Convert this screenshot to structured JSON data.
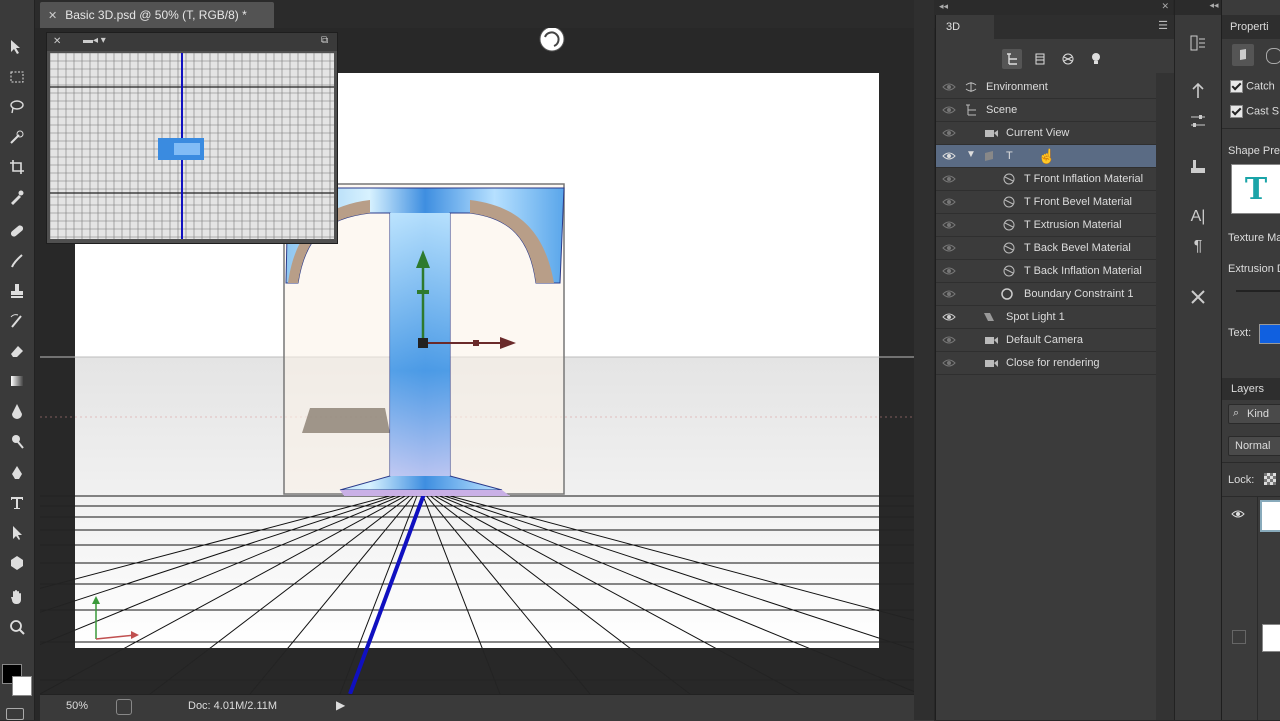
{
  "document": {
    "tab_title": "Basic 3D.psd @ 50% (T, RGB/8) *",
    "zoom": "50%",
    "doc_info": "Doc: 4.01M/2.11M"
  },
  "panel3d": {
    "tab": "3D",
    "scene_items": [
      {
        "label": "Environment",
        "icon": "environment-icon",
        "visible": true
      },
      {
        "label": "Scene",
        "icon": "scene-icon",
        "visible": true
      },
      {
        "label": "Current View",
        "icon": "camera-icon",
        "visible": true
      },
      {
        "label": "T",
        "icon": "mesh-icon",
        "visible": true,
        "selected": true
      },
      {
        "label": "T Front Inflation Material",
        "icon": "material-icon",
        "visible": true
      },
      {
        "label": "T Front Bevel Material",
        "icon": "material-icon",
        "visible": true
      },
      {
        "label": "T Extrusion Material",
        "icon": "material-icon",
        "visible": true
      },
      {
        "label": "T Back Bevel Material",
        "icon": "material-icon",
        "visible": true
      },
      {
        "label": "T Back Inflation Material",
        "icon": "material-icon",
        "visible": true
      },
      {
        "label": "Boundary Constraint 1",
        "icon": "constraint-icon",
        "visible": true
      },
      {
        "label": "Spot Light 1",
        "icon": "spotlight-icon",
        "visible": true
      },
      {
        "label": "Default Camera",
        "icon": "camera-icon",
        "visible": true
      },
      {
        "label": "Close for rendering",
        "icon": "camera-icon",
        "visible": true
      }
    ]
  },
  "properties": {
    "tab": "Properti",
    "catch_label": "Catch",
    "cast_label": "Cast S",
    "shape_presets_label": "Shape Pres",
    "texture_label": "Texture Ma",
    "extrusion_label": "Extrusion D",
    "text_label": "Text:",
    "text_color": "#1060e0",
    "preset_letter": "T"
  },
  "layers": {
    "tab": "Layers",
    "kind_label": "Kind",
    "blend_mode": "Normal",
    "lock_label": "Lock:"
  },
  "colors": {
    "accent_blue": "#1010c0",
    "selection_row": "#5a6b84"
  }
}
